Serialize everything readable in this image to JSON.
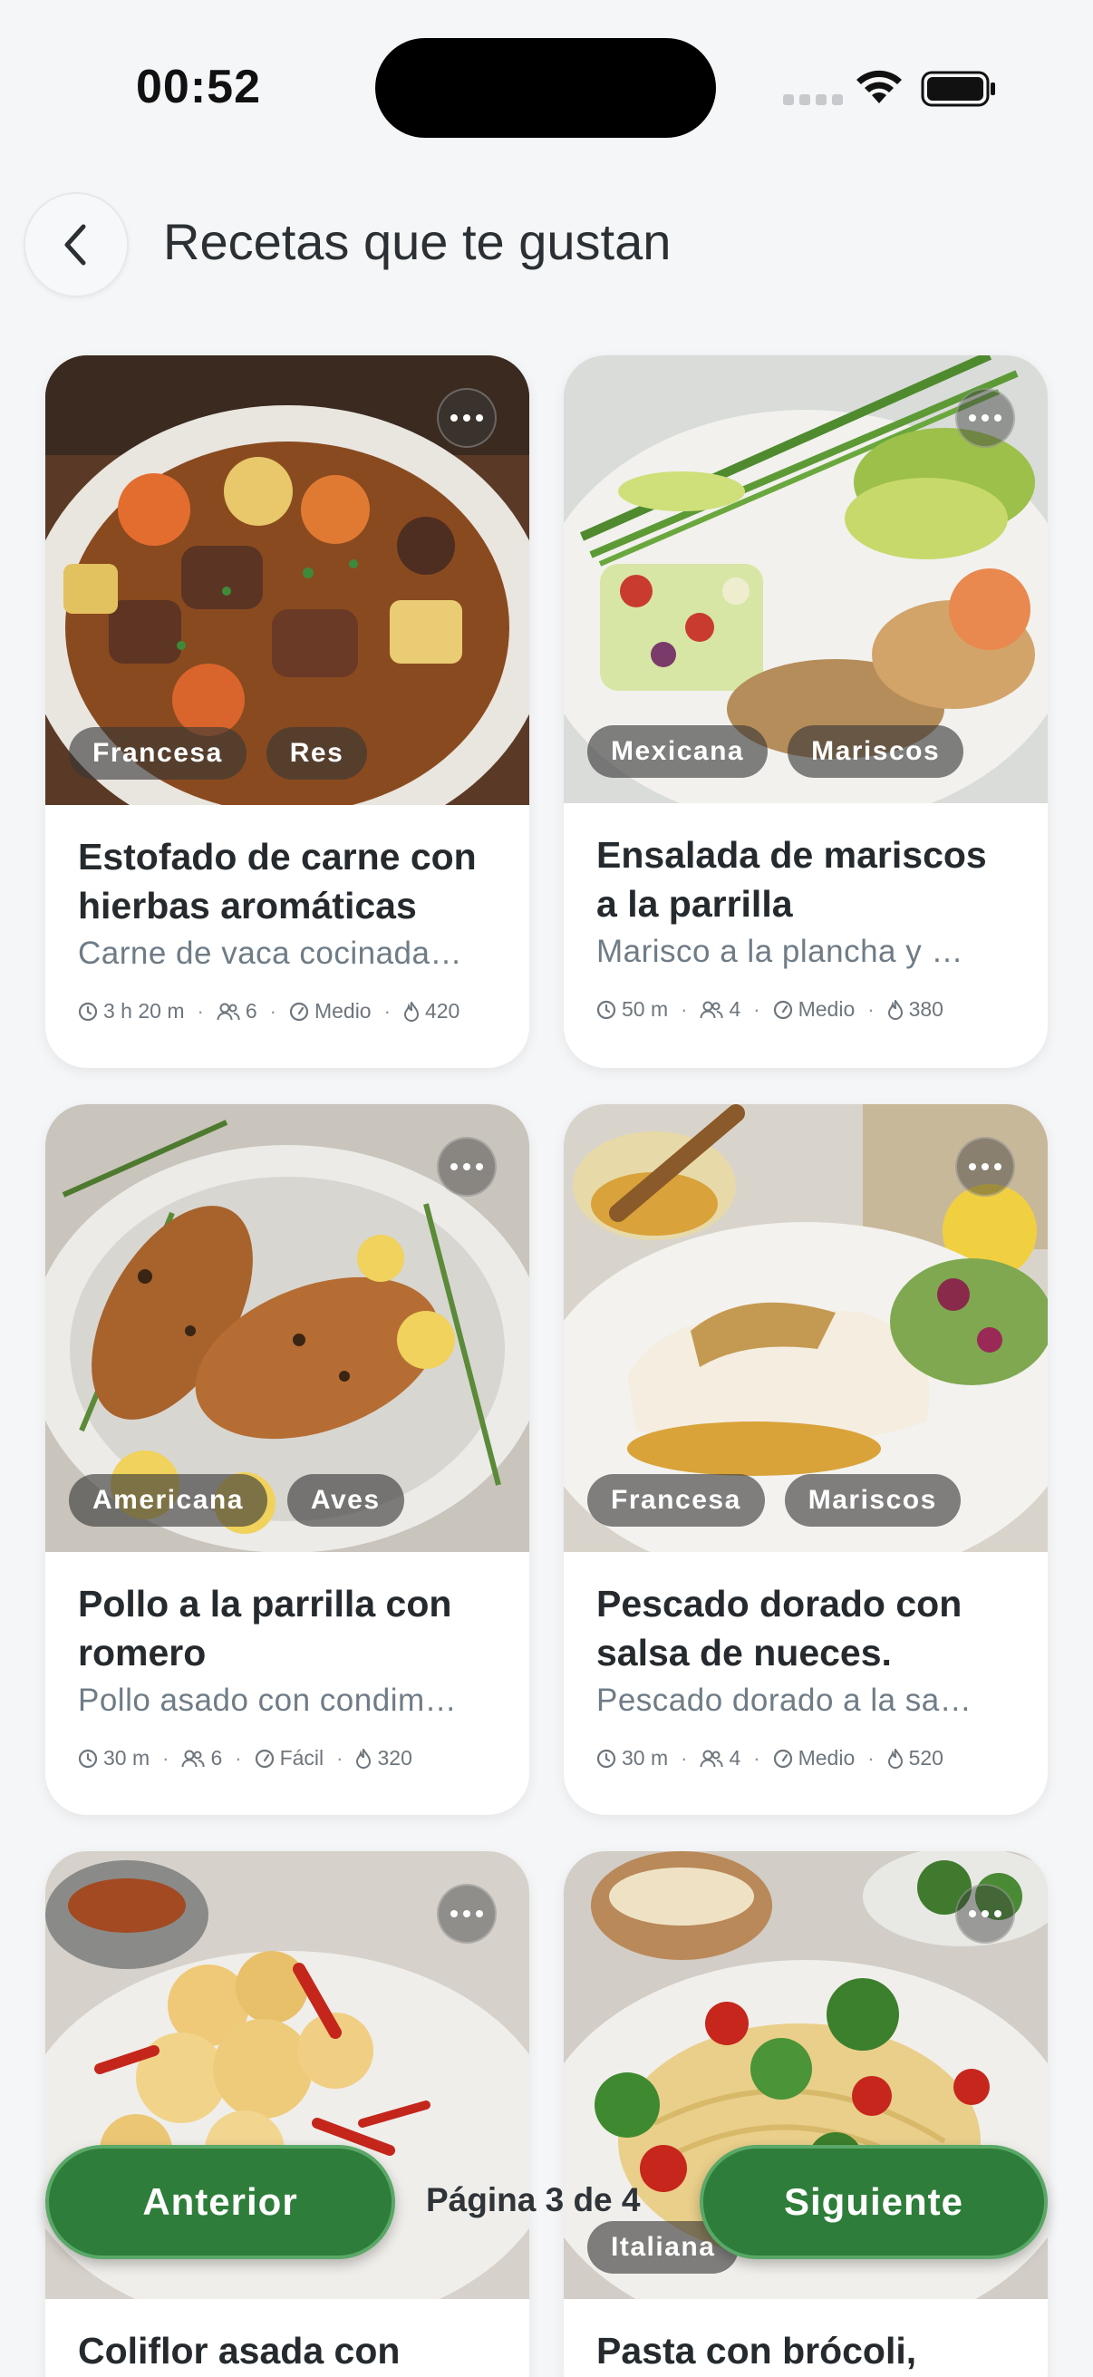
{
  "status_bar": {
    "time": "00:52"
  },
  "header": {
    "title": "Recetas que te gustan"
  },
  "recipes": [
    {
      "tags": [
        "Francesa",
        "Res"
      ],
      "title": "Estofado de carne con hierbas aromáticas",
      "description": "Carne de vaca cocinada…",
      "time": "3 h 20 m",
      "servings": "6",
      "difficulty": "Medio",
      "calories": "420",
      "image": "beef-stew-photo"
    },
    {
      "tags": [
        "Mexicana",
        "Mariscos"
      ],
      "title": "Ensalada de mariscos a la parrilla",
      "description": "Marisco a la plancha y …",
      "time": "50 m",
      "servings": "4",
      "difficulty": "Medio",
      "calories": "380",
      "image": "seafood-salad-photo"
    },
    {
      "tags": [
        "Americana",
        "Aves"
      ],
      "title": "Pollo a la parrilla con romero",
      "description": "Pollo asado con condim…",
      "time": "30 m",
      "servings": "6",
      "difficulty": "Fácil",
      "calories": "320",
      "image": "grilled-chicken-photo"
    },
    {
      "tags": [
        "Francesa",
        "Mariscos"
      ],
      "title": "Pescado dorado con salsa de nueces.",
      "description": "Pescado dorado a la sa…",
      "time": "30 m",
      "servings": "4",
      "difficulty": "Medio",
      "calories": "520",
      "image": "fish-walnut-photo"
    },
    {
      "tags": [],
      "title": "Coliflor asada con",
      "description": "",
      "image": "roasted-cauliflower-photo"
    },
    {
      "tags": [
        "Italiana"
      ],
      "title": "Pasta con brócoli,",
      "description": "",
      "image": "broccoli-pasta-photo"
    }
  ],
  "pagination": {
    "prev_label": "Anterior",
    "next_label": "Siguiente",
    "indicator": "Página 3 de 4"
  },
  "colors": {
    "primary_green": "#2e7d3a",
    "background": "#f5f6f8",
    "tag_bg": "rgba(55,55,55,0.62)"
  }
}
